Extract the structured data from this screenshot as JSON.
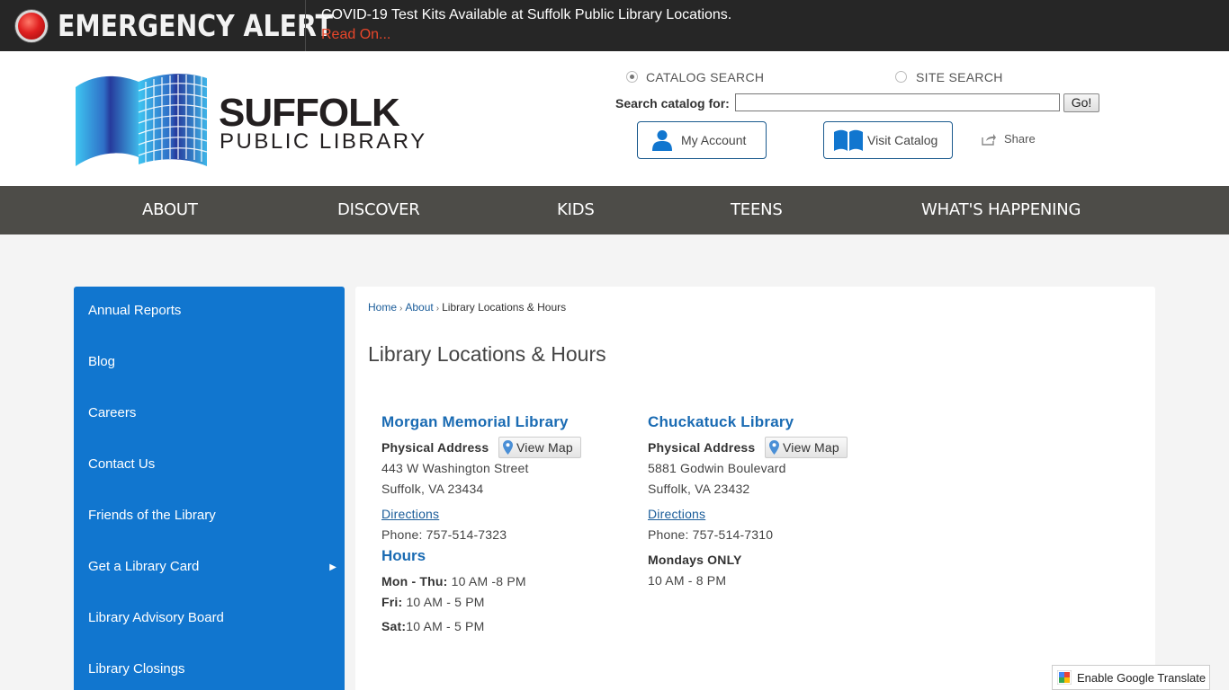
{
  "alert": {
    "title": "EMERGENCY ALERT",
    "message": "COVID-19 Test Kits Available at Suffolk Public Library Locations.",
    "link": "Read On..."
  },
  "logo": {
    "line1": "SUFFOLK",
    "line2": "PUBLIC LIBRARY"
  },
  "search": {
    "option_catalog": "CATALOG SEARCH",
    "option_site": "SITE SEARCH",
    "selected": "CATALOG SEARCH",
    "label": "Search catalog for:",
    "value": "",
    "go": "Go!"
  },
  "header_buttons": {
    "my_account": "My Account",
    "visit_catalog": "Visit Catalog",
    "share": "Share"
  },
  "nav": [
    "ABOUT",
    "DISCOVER",
    "KIDS",
    "TEENS",
    "WHAT'S HAPPENING"
  ],
  "sidebar": [
    "Annual Reports",
    "Blog",
    "Careers",
    "Contact Us",
    "Friends of the Library",
    "Get a Library Card",
    "Library Advisory Board",
    "Library Closings"
  ],
  "breadcrumb": {
    "home": "Home",
    "about": "About",
    "current": "Library Locations & Hours",
    "sep": "›"
  },
  "page_title": "Library Locations & Hours",
  "locations": [
    {
      "name": "Morgan Memorial Library",
      "address_label": "Physical Address",
      "map_label": "View Map",
      "street": "443 W Washington Street",
      "city": "Suffolk, VA 23434",
      "directions": "Directions",
      "phone": "Phone: 757-514-7323",
      "hours_heading": "Hours",
      "hours": [
        {
          "day": "Mon - Thu:",
          "time": " 10 AM -8 PM"
        },
        {
          "day": "Fri:",
          "time": " 10 AM - 5 PM"
        },
        {
          "day": "Sat:",
          "time": "10 AM - 5 PM"
        }
      ]
    },
    {
      "name": "Chuckatuck Library",
      "address_label": "Physical Address",
      "map_label": "View Map",
      "street": "5881 Godwin Boulevard",
      "city": "Suffolk, VA 23432",
      "directions": "Directions",
      "phone": "Phone: 757-514-7310",
      "days_note": "Mondays ONLY",
      "hours_note": "10 AM - 8 PM"
    }
  ],
  "translate": "Enable Google Translate",
  "colors": {
    "accent_blue": "#1176cf",
    "link_blue": "#1a6bb3",
    "nav_bg": "#4d4c48",
    "alert_bg": "#262626",
    "alert_link": "#e8462a"
  }
}
